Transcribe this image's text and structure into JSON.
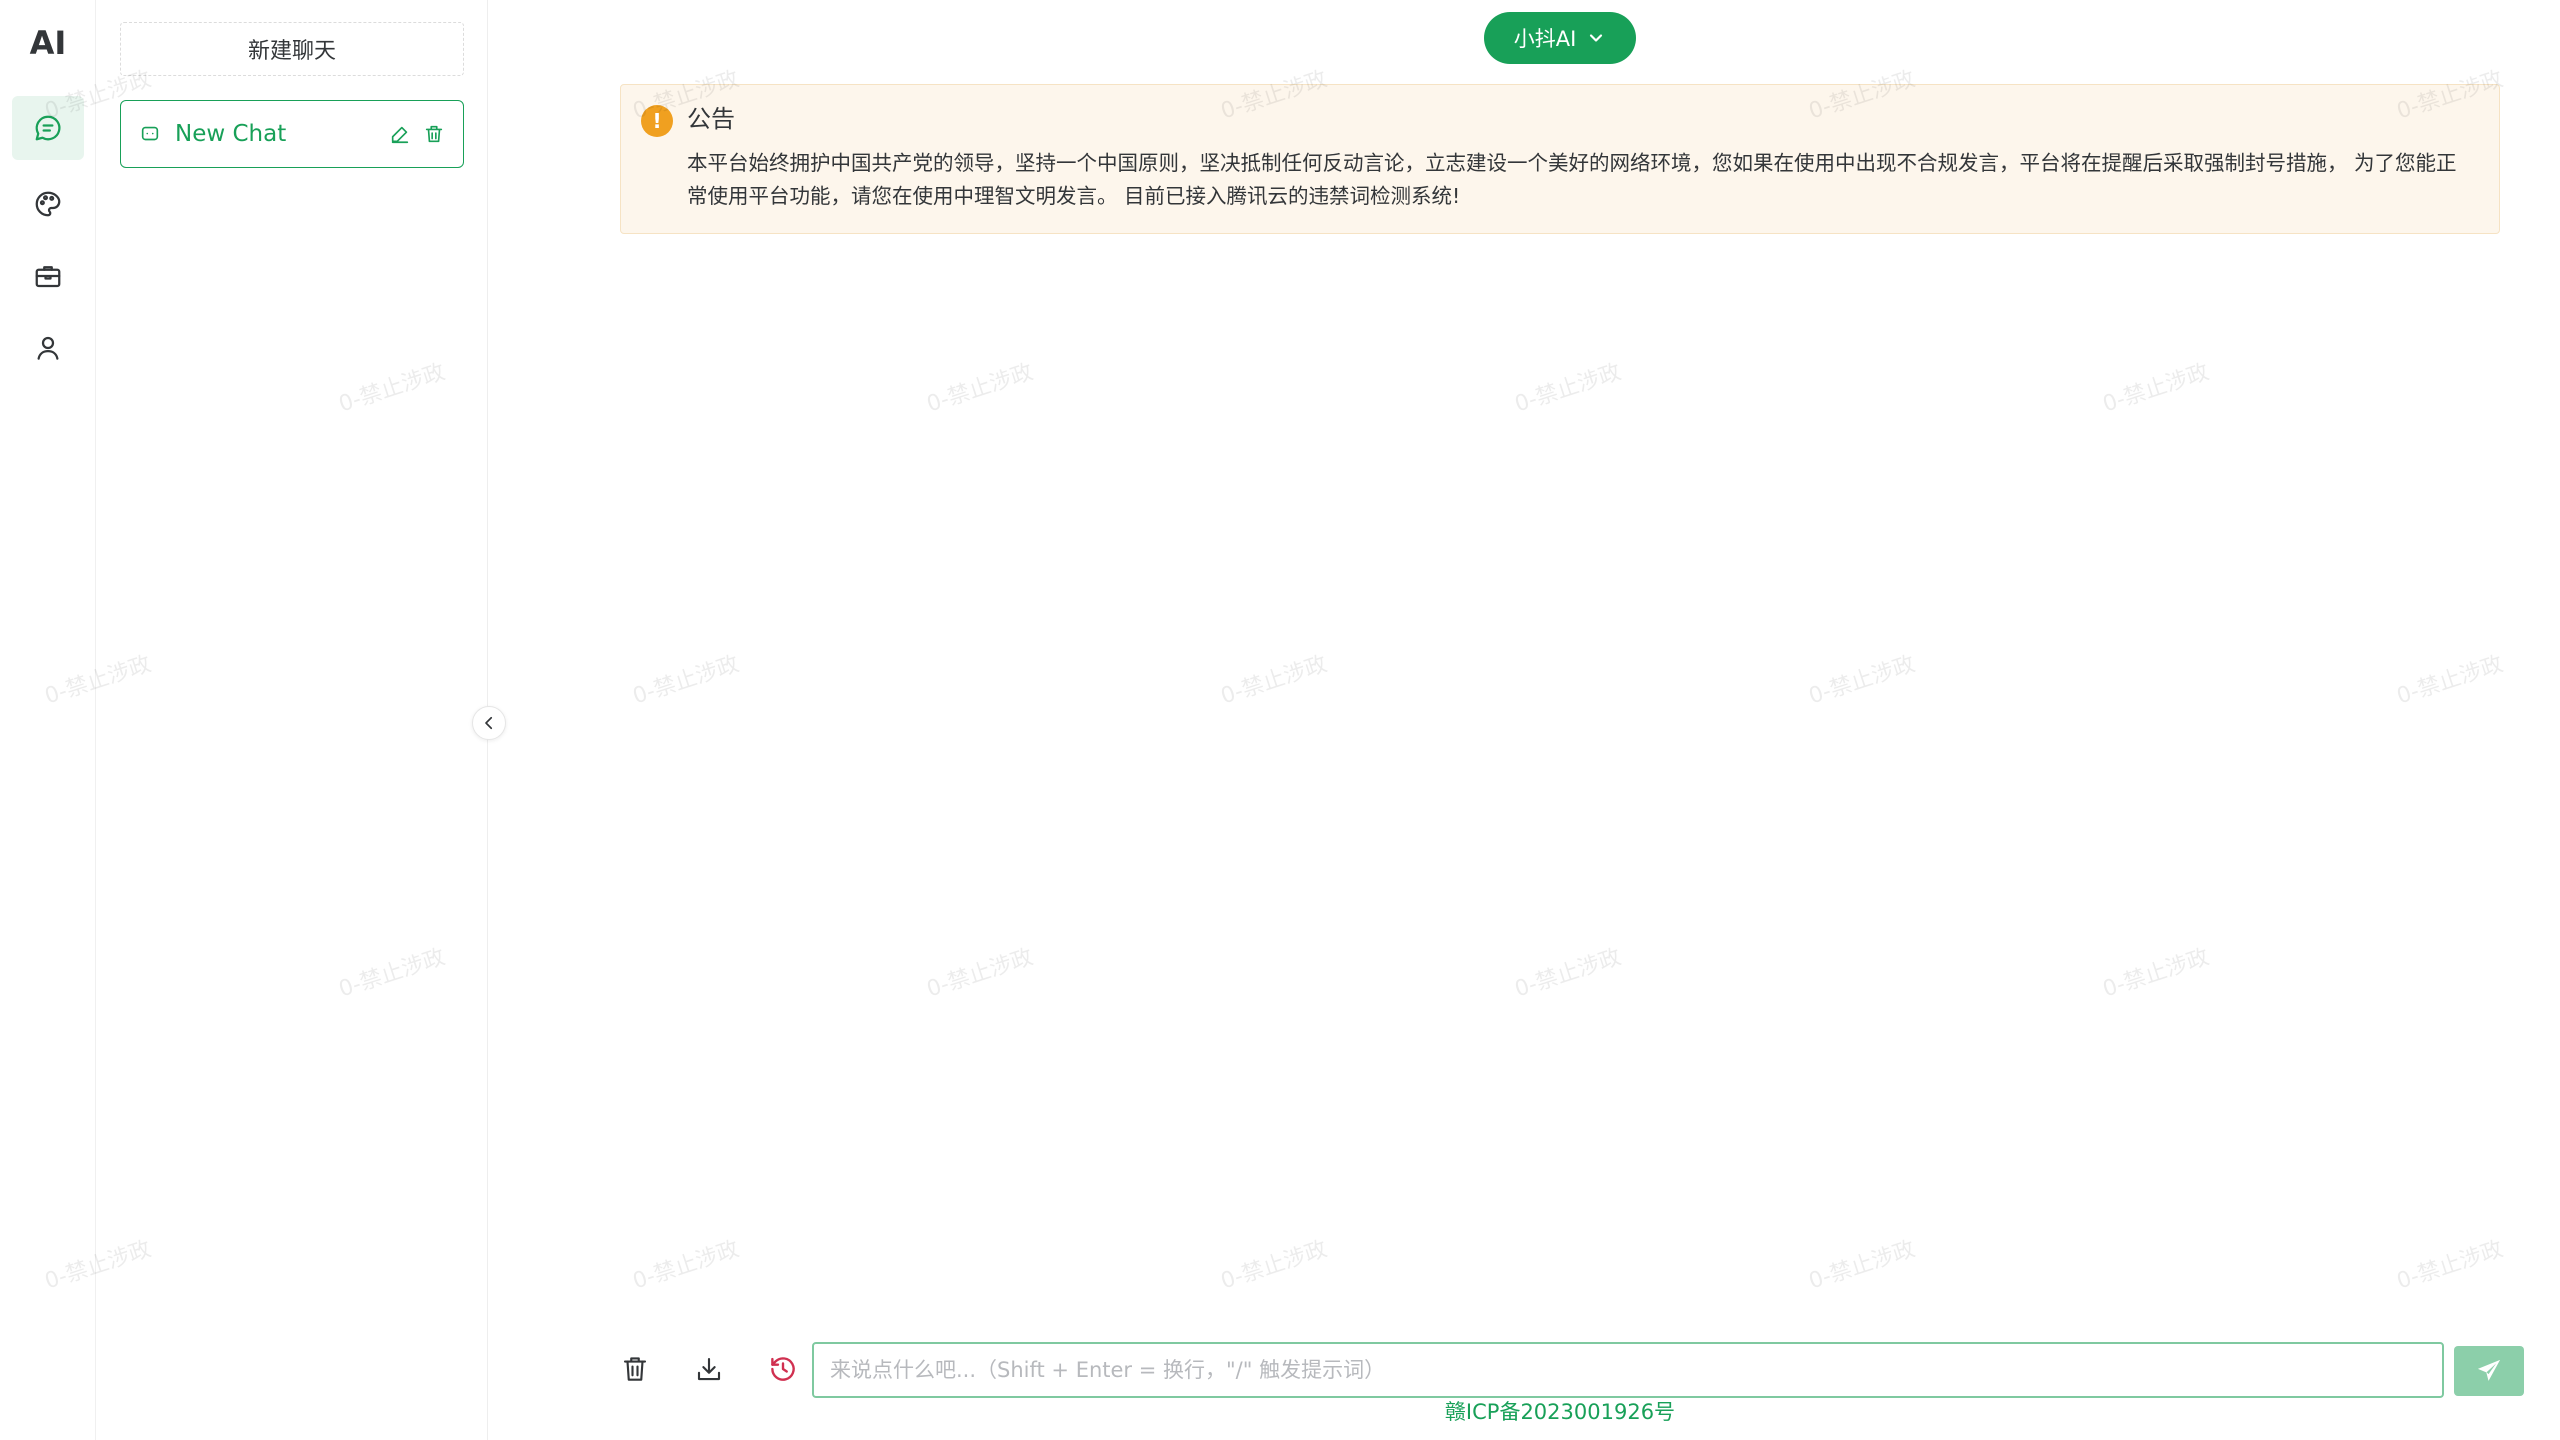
{
  "app": {
    "logo": "AI"
  },
  "rail": {
    "items": [
      {
        "name": "chat",
        "icon": "chat-icon",
        "active": true
      },
      {
        "name": "draw",
        "icon": "palette-icon",
        "active": false
      },
      {
        "name": "store",
        "icon": "toolbox-icon",
        "active": false
      },
      {
        "name": "user",
        "icon": "user-icon",
        "active": false
      }
    ]
  },
  "sidebar": {
    "new_chat_label": "新建聊天",
    "sessions": [
      {
        "title": "New Chat",
        "active": true
      }
    ]
  },
  "header": {
    "model_label": "小抖AI"
  },
  "notice": {
    "title": "公告",
    "body": "本平台始终拥护中国共产党的领导，坚持一个中国原则，坚决抵制任何反动言论，立志建设一个美好的网络环境，您如果在使用中出现不合规发言，平台将在提醒后采取强制封号措施， 为了您能正常使用平台功能，请您在使用中理智文明发言。 目前已接入腾讯云的违禁词检测系统!"
  },
  "footer": {
    "input_placeholder": "来说点什么吧...（Shift + Enter = 换行，\"/\" 触发提示词）",
    "input_value": "",
    "icp": "赣ICP备2023001926号"
  },
  "watermark": {
    "text": "0-禁止涉政"
  },
  "colors": {
    "primary": "#18a058",
    "primary_light": "#8ccfaa",
    "warning": "#f0a020",
    "notice_bg": "#fdf6ec",
    "history_icon": "#d03050"
  }
}
